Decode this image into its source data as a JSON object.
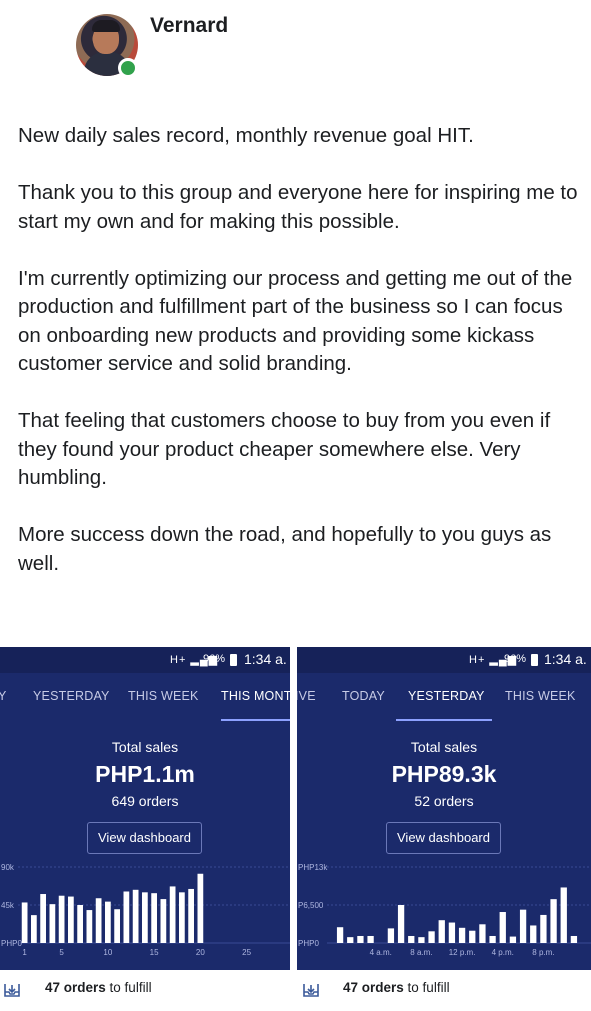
{
  "post": {
    "author": "Vernard",
    "paragraphs": [
      "New daily sales record, monthly revenue goal HIT.",
      "Thank you to this group and everyone here for inspiring me to start my own and for making this possible.",
      "I'm currently optimizing our process and getting me out of the production and fulfillment part of the business so I can focus on onboarding new products and providing some kickass customer service and solid branding.",
      "That feeling that customers choose to buy from you even if they found your product cheaper somewhere else. Very humbling.",
      "More success down the road, and hopefully to you guys as well."
    ]
  },
  "left_screen": {
    "status": {
      "network": "H+",
      "battery": "96%",
      "time": "1:34 a."
    },
    "tabs": [
      "Y",
      "YESTERDAY",
      "THIS WEEK",
      "THIS MONTH"
    ],
    "active_tab": "THIS MONTH",
    "total_sales_label": "Total sales",
    "total_sales_value": "PHP1.1m",
    "orders": "649 orders",
    "view_dashboard": "View dashboard",
    "fulfill_count": "47 orders",
    "fulfill_text": " to fulfill",
    "accent": "#1b2a6b"
  },
  "right_screen": {
    "status": {
      "network": "H+",
      "battery": "96%",
      "time": "1:34 a."
    },
    "tabs": [
      "IVE",
      "TODAY",
      "YESTERDAY",
      "THIS WEEK"
    ],
    "active_tab": "YESTERDAY",
    "total_sales_label": "Total sales",
    "total_sales_value": "PHP89.3k",
    "orders": "52 orders",
    "view_dashboard": "View dashboard",
    "fulfill_count": "47 orders",
    "fulfill_text": " to fulfill"
  },
  "chart_data": [
    {
      "type": "bar",
      "y_ticks": [
        "90k",
        "45k",
        "PHP0"
      ],
      "ylim": [
        0,
        90000
      ],
      "x_ticks": [
        "1",
        "5",
        "10",
        "15",
        "20",
        "25"
      ],
      "x": [
        1,
        2,
        3,
        4,
        5,
        6,
        7,
        8,
        9,
        10,
        11,
        12,
        13,
        14,
        15,
        16,
        17,
        18,
        19,
        20
      ],
      "values": [
        48000,
        33000,
        58000,
        46000,
        56000,
        55000,
        45000,
        39000,
        53000,
        49000,
        40000,
        61000,
        63000,
        60000,
        59000,
        52000,
        67000,
        60000,
        64000,
        82000
      ]
    },
    {
      "type": "bar",
      "y_ticks": [
        "PHP13k",
        "P6,500",
        "PHP0"
      ],
      "ylim": [
        0,
        13000
      ],
      "x_ticks": [
        "4 a.m.",
        "8 a.m.",
        "12 p.m.",
        "4 p.m.",
        "8 p.m."
      ],
      "x": [
        "0",
        "1",
        "2",
        "3",
        "4",
        "5",
        "6",
        "7",
        "8",
        "9",
        "10",
        "11",
        "12",
        "13",
        "14",
        "15",
        "16",
        "17",
        "18",
        "19",
        "20",
        "21",
        "22",
        "23"
      ],
      "values": [
        2700,
        1000,
        1200,
        1200,
        0,
        2500,
        6500,
        1200,
        1000,
        2000,
        3900,
        3500,
        2600,
        2100,
        3200,
        1200,
        5300,
        1100,
        5700,
        3000,
        4800,
        7500,
        9500,
        1200
      ]
    }
  ]
}
